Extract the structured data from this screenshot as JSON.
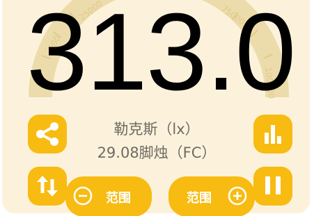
{
  "meter": {
    "reading": "313.0",
    "unit_lux": "勒克斯（lx）",
    "foot_candle": "29.08脚烛（FC）"
  },
  "dial": {
    "scale_labels": [
      "25000",
      "500",
      "75000",
      "100000"
    ]
  },
  "controls": {
    "range_minus_label": "范围",
    "range_plus_label": "范围"
  },
  "icons": {
    "share": "share-icon",
    "chart": "bar-chart-icon",
    "swap": "swap-vertical-icon",
    "pause": "pause-icon",
    "minus": "minus-circle-icon",
    "plus": "plus-circle-icon"
  },
  "colors": {
    "background": "#fcf2dc",
    "accent": "#f7bb12",
    "dial": "#ecdcab",
    "dial_text": "#e0c98c",
    "reading_text": "#000000",
    "secondary_text": "#6f6a62"
  }
}
